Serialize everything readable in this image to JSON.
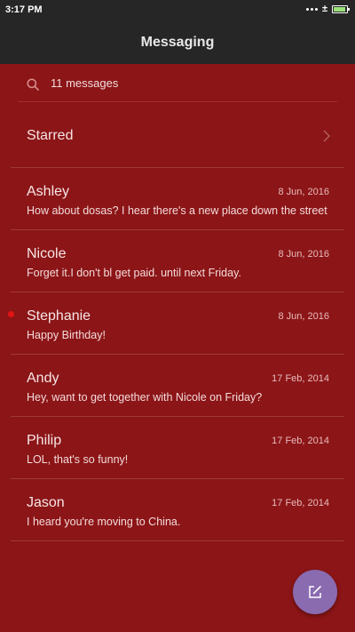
{
  "status": {
    "time": "3:17 PM",
    "plus": "±",
    "battery_level": 0.9
  },
  "header": {
    "title": "Messaging"
  },
  "search": {
    "label": "11 messages"
  },
  "starred": {
    "label": "Starred"
  },
  "conversations": [
    {
      "name": "Ashley",
      "date": "8 Jun, 2016",
      "preview": "How about dosas? I hear there's a new place down the street"
    },
    {
      "name": "Nicole",
      "date": "8 Jun, 2016",
      "preview": "Forget it.I don't bl get paid. until next Friday."
    },
    {
      "name": "Stephanie",
      "date": "8 Jun, 2016",
      "preview": "Happy Birthday!"
    },
    {
      "name": "Andy",
      "date": "17 Feb, 2014",
      "preview": "Hey, want to get together with Nicole on Friday?"
    },
    {
      "name": "Philip",
      "date": "17 Feb, 2014",
      "preview": "LOL, that's so funny!"
    },
    {
      "name": "Jason",
      "date": "17 Feb, 2014",
      "preview": "I heard you're moving to China."
    }
  ],
  "colors": {
    "background": "#8c1517",
    "bar": "#262626",
    "fab": "#8a6bb0",
    "unread_dot": "#e31414"
  },
  "icons": {
    "search": "search-icon",
    "chevron": "chevron-right-icon",
    "compose": "compose-icon"
  }
}
